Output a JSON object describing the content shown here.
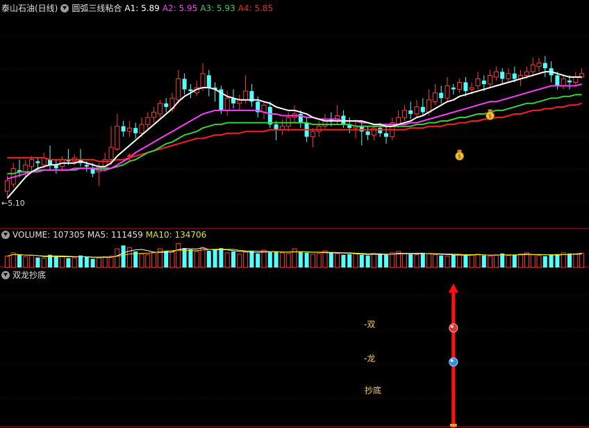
{
  "header": {
    "stock": "泰山石油(日线)",
    "indicator": "圆弧三线粘合",
    "a1": "A1: 5.89",
    "a2": "A2: 5.95",
    "a3": "A3: 5.93",
    "a4": "A4: 5.85"
  },
  "volume_header": {
    "volume": "VOLUME: 107305",
    "ma5": "MA5: 111459",
    "ma10": "MA10: 134706"
  },
  "signal_header": {
    "name": "双龙抄底"
  },
  "price_low_label": "5.10",
  "signal_labels": {
    "shuang": "双",
    "long": "龙",
    "chaodi": "抄底"
  },
  "colors": {
    "up": "#ff3c3c",
    "down": "#54ffff",
    "a1": "#ffffff",
    "a2": "#ff3cff",
    "a3": "#3cd23c",
    "a4": "#ff2020",
    "grid": "#5a0000",
    "sep": "#b40000",
    "ma10": "#e6e600"
  },
  "chart_data": [
    {
      "type": "candlestick",
      "title": "泰山石油(日线)",
      "ylim": [
        5.05,
        5.98
      ],
      "candles": [
        [
          5.18,
          5.24,
          5.15,
          5.27
        ],
        [
          5.22,
          5.31,
          5.2,
          5.34
        ],
        [
          5.3,
          5.29,
          5.26,
          5.36
        ],
        [
          5.29,
          5.33,
          5.26,
          5.36
        ],
        [
          5.32,
          5.36,
          5.29,
          5.38
        ],
        [
          5.35,
          5.34,
          5.3,
          5.37
        ],
        [
          5.33,
          5.37,
          5.31,
          5.4
        ],
        [
          5.36,
          5.33,
          5.3,
          5.44
        ],
        [
          5.33,
          5.31,
          5.28,
          5.36
        ],
        [
          5.32,
          5.36,
          5.3,
          5.38
        ],
        [
          5.36,
          5.35,
          5.33,
          5.42
        ],
        [
          5.35,
          5.37,
          5.33,
          5.39
        ],
        [
          5.36,
          5.34,
          5.32,
          5.42
        ],
        [
          5.33,
          5.32,
          5.29,
          5.35
        ],
        [
          5.31,
          5.28,
          5.26,
          5.34
        ],
        [
          5.29,
          5.32,
          5.21,
          5.34
        ],
        [
          5.31,
          5.36,
          5.29,
          5.4
        ],
        [
          5.36,
          5.43,
          5.33,
          5.55
        ],
        [
          5.42,
          5.55,
          5.41,
          5.62
        ],
        [
          5.55,
          5.52,
          5.49,
          5.58
        ],
        [
          5.52,
          5.54,
          5.49,
          5.58
        ],
        [
          5.54,
          5.51,
          5.48,
          5.57
        ],
        [
          5.51,
          5.56,
          5.49,
          5.6
        ],
        [
          5.56,
          5.6,
          5.53,
          5.63
        ],
        [
          5.6,
          5.63,
          5.57,
          5.66
        ],
        [
          5.62,
          5.68,
          5.6,
          5.7
        ],
        [
          5.68,
          5.66,
          5.63,
          5.71
        ],
        [
          5.65,
          5.71,
          5.63,
          5.74
        ],
        [
          5.7,
          5.82,
          5.68,
          5.87
        ],
        [
          5.82,
          5.76,
          5.73,
          5.85
        ],
        [
          5.76,
          5.75,
          5.71,
          5.79
        ],
        [
          5.74,
          5.77,
          5.72,
          5.81
        ],
        [
          5.77,
          5.85,
          5.75,
          5.91
        ],
        [
          5.84,
          5.77,
          5.72,
          5.87
        ],
        [
          5.77,
          5.76,
          5.69,
          5.8
        ],
        [
          5.76,
          5.64,
          5.62,
          5.78
        ],
        [
          5.64,
          5.71,
          5.61,
          5.75
        ],
        [
          5.71,
          5.68,
          5.65,
          5.76
        ],
        [
          5.68,
          5.7,
          5.64,
          5.73
        ],
        [
          5.7,
          5.75,
          5.68,
          5.84
        ],
        [
          5.75,
          5.69,
          5.66,
          5.79
        ],
        [
          5.69,
          5.63,
          5.6,
          5.72
        ],
        [
          5.63,
          5.67,
          5.59,
          5.69
        ],
        [
          5.66,
          5.56,
          5.54,
          5.69
        ],
        [
          5.56,
          5.53,
          5.47,
          5.58
        ],
        [
          5.53,
          5.55,
          5.5,
          5.59
        ],
        [
          5.55,
          5.6,
          5.52,
          5.63
        ],
        [
          5.6,
          5.62,
          5.57,
          5.67
        ],
        [
          5.62,
          5.57,
          5.54,
          5.64
        ],
        [
          5.57,
          5.49,
          5.46,
          5.6
        ],
        [
          5.49,
          5.52,
          5.43,
          5.54
        ],
        [
          5.52,
          5.55,
          5.49,
          5.58
        ],
        [
          5.55,
          5.59,
          5.53,
          5.62
        ],
        [
          5.59,
          5.58,
          5.55,
          5.63
        ],
        [
          5.58,
          5.61,
          5.56,
          5.67
        ],
        [
          5.61,
          5.56,
          5.54,
          5.64
        ],
        [
          5.56,
          5.54,
          5.51,
          5.6
        ],
        [
          5.54,
          5.55,
          5.48,
          5.59
        ],
        [
          5.55,
          5.52,
          5.44,
          5.58
        ],
        [
          5.52,
          5.5,
          5.47,
          5.55
        ],
        [
          5.5,
          5.54,
          5.47,
          5.56
        ],
        [
          5.54,
          5.51,
          5.49,
          5.57
        ],
        [
          5.51,
          5.49,
          5.45,
          5.55
        ],
        [
          5.49,
          5.57,
          5.47,
          5.6
        ],
        [
          5.56,
          5.6,
          5.54,
          5.64
        ],
        [
          5.6,
          5.64,
          5.58,
          5.67
        ],
        [
          5.64,
          5.62,
          5.59,
          5.69
        ],
        [
          5.62,
          5.66,
          5.6,
          5.7
        ],
        [
          5.66,
          5.63,
          5.61,
          5.71
        ],
        [
          5.63,
          5.7,
          5.61,
          5.76
        ],
        [
          5.69,
          5.74,
          5.67,
          5.79
        ],
        [
          5.74,
          5.71,
          5.68,
          5.78
        ],
        [
          5.71,
          5.78,
          5.69,
          5.83
        ],
        [
          5.77,
          5.76,
          5.73,
          5.79
        ],
        [
          5.76,
          5.8,
          5.74,
          5.82
        ],
        [
          5.8,
          5.75,
          5.72,
          5.83
        ],
        [
          5.76,
          5.77,
          5.73,
          5.8
        ],
        [
          5.78,
          5.82,
          5.76,
          5.86
        ],
        [
          5.81,
          5.79,
          5.75,
          5.84
        ],
        [
          5.79,
          5.84,
          5.77,
          5.87
        ],
        [
          5.83,
          5.86,
          5.81,
          5.89
        ],
        [
          5.86,
          5.82,
          5.79,
          5.88
        ],
        [
          5.82,
          5.85,
          5.8,
          5.88
        ],
        [
          5.85,
          5.82,
          5.8,
          5.89
        ],
        [
          5.82,
          5.84,
          5.78,
          5.87
        ],
        [
          5.84,
          5.86,
          5.82,
          5.89
        ],
        [
          5.86,
          5.9,
          5.84,
          5.94
        ],
        [
          5.89,
          5.91,
          5.86,
          5.94
        ],
        [
          5.91,
          5.88,
          5.83,
          5.95
        ],
        [
          5.88,
          5.84,
          5.8,
          5.92
        ],
        [
          5.84,
          5.78,
          5.76,
          5.86
        ],
        [
          5.78,
          5.82,
          5.76,
          5.84
        ],
        [
          5.81,
          5.8,
          5.76,
          5.84
        ],
        [
          5.8,
          5.83,
          5.78,
          5.86
        ],
        [
          5.83,
          5.85,
          5.82,
          5.88
        ]
      ],
      "a1": [
        5.14,
        5.18,
        5.22,
        5.26,
        5.29,
        5.31,
        5.32,
        5.33,
        5.33,
        5.34,
        5.34,
        5.34,
        5.35,
        5.34,
        5.33,
        5.32,
        5.32,
        5.34,
        5.38,
        5.41,
        5.44,
        5.47,
        5.5,
        5.53,
        5.56,
        5.59,
        5.62,
        5.65,
        5.69,
        5.72,
        5.74,
        5.76,
        5.77,
        5.77,
        5.76,
        5.74,
        5.72,
        5.71,
        5.7,
        5.7,
        5.7,
        5.7,
        5.69,
        5.68,
        5.66,
        5.65,
        5.64,
        5.64,
        5.63,
        5.62,
        5.6,
        5.59,
        5.58,
        5.58,
        5.58,
        5.58,
        5.58,
        5.58,
        5.58,
        5.57,
        5.56,
        5.56,
        5.55,
        5.55,
        5.56,
        5.57,
        5.58,
        5.6,
        5.61,
        5.63,
        5.65,
        5.67,
        5.69,
        5.7,
        5.72,
        5.73,
        5.74,
        5.75,
        5.76,
        5.77,
        5.78,
        5.79,
        5.8,
        5.81,
        5.82,
        5.83,
        5.84,
        5.85,
        5.86,
        5.86,
        5.85,
        5.84,
        5.83,
        5.83,
        5.83
      ],
      "a2": [
        5.25,
        5.26,
        5.27,
        5.28,
        5.29,
        5.29,
        5.3,
        5.3,
        5.3,
        5.3,
        5.3,
        5.31,
        5.31,
        5.31,
        5.31,
        5.3,
        5.3,
        5.31,
        5.33,
        5.35,
        5.37,
        5.4,
        5.42,
        5.44,
        5.46,
        5.48,
        5.5,
        5.52,
        5.54,
        5.56,
        5.58,
        5.6,
        5.62,
        5.63,
        5.64,
        5.64,
        5.64,
        5.64,
        5.64,
        5.64,
        5.64,
        5.64,
        5.63,
        5.62,
        5.62,
        5.61,
        5.61,
        5.61,
        5.61,
        5.6,
        5.6,
        5.59,
        5.59,
        5.59,
        5.59,
        5.58,
        5.58,
        5.58,
        5.57,
        5.57,
        5.56,
        5.56,
        5.56,
        5.56,
        5.56,
        5.56,
        5.57,
        5.57,
        5.58,
        5.59,
        5.6,
        5.61,
        5.62,
        5.63,
        5.64,
        5.65,
        5.66,
        5.67,
        5.68,
        5.69,
        5.69,
        5.7,
        5.71,
        5.72,
        5.73,
        5.74,
        5.75,
        5.76,
        5.77,
        5.78,
        5.78,
        5.78,
        5.78,
        5.78,
        5.79
      ],
      "a3": [
        5.28,
        5.28,
        5.29,
        5.29,
        5.29,
        5.3,
        5.3,
        5.3,
        5.3,
        5.3,
        5.3,
        5.3,
        5.31,
        5.31,
        5.31,
        5.31,
        5.31,
        5.31,
        5.32,
        5.33,
        5.35,
        5.36,
        5.38,
        5.4,
        5.41,
        5.43,
        5.45,
        5.46,
        5.48,
        5.5,
        5.51,
        5.52,
        5.54,
        5.55,
        5.56,
        5.56,
        5.57,
        5.57,
        5.57,
        5.57,
        5.57,
        5.57,
        5.57,
        5.57,
        5.57,
        5.57,
        5.57,
        5.57,
        5.57,
        5.57,
        5.56,
        5.56,
        5.56,
        5.56,
        5.56,
        5.56,
        5.56,
        5.55,
        5.55,
        5.55,
        5.55,
        5.55,
        5.55,
        5.55,
        5.55,
        5.55,
        5.55,
        5.56,
        5.56,
        5.57,
        5.57,
        5.58,
        5.58,
        5.59,
        5.6,
        5.6,
        5.61,
        5.62,
        5.62,
        5.63,
        5.64,
        5.64,
        5.65,
        5.66,
        5.67,
        5.68,
        5.68,
        5.69,
        5.7,
        5.71,
        5.71,
        5.72,
        5.72,
        5.73,
        5.73
      ],
      "a4": [
        5.37,
        5.37,
        5.37,
        5.37,
        5.37,
        5.37,
        5.37,
        5.36,
        5.36,
        5.36,
        5.36,
        5.36,
        5.36,
        5.36,
        5.36,
        5.35,
        5.35,
        5.35,
        5.36,
        5.36,
        5.37,
        5.38,
        5.39,
        5.4,
        5.41,
        5.42,
        5.43,
        5.44,
        5.45,
        5.46,
        5.47,
        5.48,
        5.48,
        5.49,
        5.5,
        5.5,
        5.51,
        5.51,
        5.51,
        5.52,
        5.52,
        5.52,
        5.52,
        5.53,
        5.53,
        5.53,
        5.53,
        5.53,
        5.53,
        5.53,
        5.53,
        5.53,
        5.53,
        5.53,
        5.53,
        5.53,
        5.53,
        5.53,
        5.53,
        5.53,
        5.53,
        5.53,
        5.53,
        5.53,
        5.53,
        5.53,
        5.54,
        5.54,
        5.54,
        5.55,
        5.55,
        5.55,
        5.56,
        5.56,
        5.57,
        5.57,
        5.58,
        5.58,
        5.59,
        5.59,
        5.6,
        5.6,
        5.61,
        5.62,
        5.62,
        5.63,
        5.64,
        5.64,
        5.65,
        5.65,
        5.66,
        5.66,
        5.67,
        5.67,
        5.68
      ],
      "markers": [
        {
          "type": "up-arrow",
          "index": 20
        },
        {
          "type": "money-bag",
          "index": 79,
          "value": 5.61
        },
        {
          "type": "money-bag",
          "index": 74,
          "value": 5.38
        }
      ]
    },
    {
      "type": "bar",
      "title": "VOLUME",
      "ylim": [
        0,
        260000
      ],
      "values": [
        85000,
        110000,
        95000,
        80000,
        90000,
        75000,
        70000,
        95000,
        80000,
        85000,
        70000,
        75000,
        90000,
        80000,
        65000,
        70000,
        80000,
        85000,
        140000,
        165000,
        150000,
        120000,
        100000,
        95000,
        110000,
        140000,
        125000,
        115000,
        180000,
        145000,
        135000,
        120000,
        150000,
        125000,
        130000,
        145000,
        110000,
        120000,
        100000,
        115000,
        125000,
        105000,
        130000,
        115000,
        120000,
        110000,
        105000,
        140000,
        115000,
        110000,
        100000,
        105000,
        125000,
        110000,
        105000,
        95000,
        100000,
        105000,
        95000,
        90000,
        105000,
        100000,
        95000,
        110000,
        120000,
        105000,
        100000,
        95000,
        110000,
        105000,
        95000,
        90000,
        85000,
        95000,
        100000,
        90000,
        95000,
        100000,
        90000,
        85000,
        95000,
        105000,
        90000,
        95000,
        100000,
        110000,
        95000,
        90000,
        85000,
        95000,
        100000,
        110000,
        105000,
        100000,
        107305
      ],
      "ma5": [],
      "ma10": []
    },
    {
      "type": "line",
      "title": "双龙抄底",
      "signal_index": 73
    }
  ]
}
